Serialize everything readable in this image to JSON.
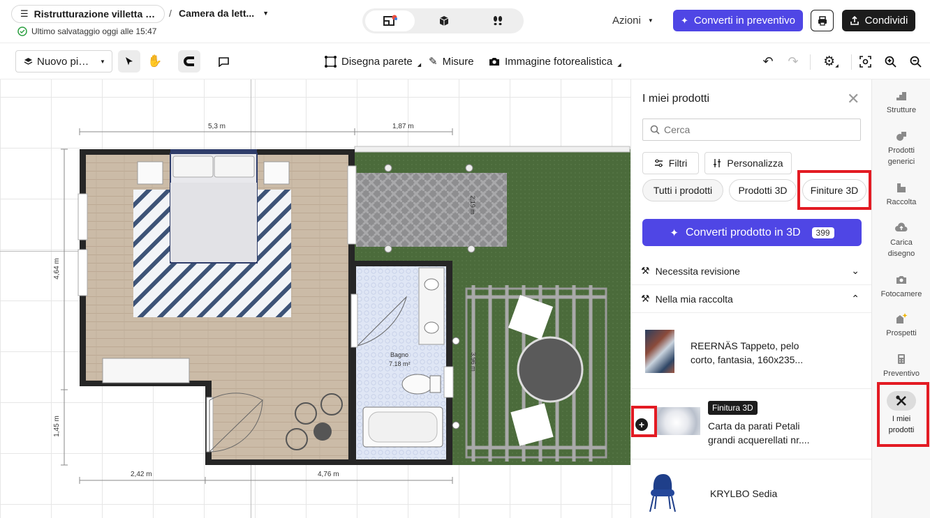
{
  "topbar": {
    "project_title": "Ristrutturazione villetta a ...",
    "separator": "/",
    "room_title": "Camera da lett...",
    "save_status": "Ultimo salvataggio oggi alle 15:47",
    "actions_label": "Azioni",
    "convert_button": "Converti in preventivo",
    "share_button": "Condividi"
  },
  "toolbar": {
    "floor_select": "Nuovo pia...",
    "draw_wall": "Disegna parete",
    "measures": "Misure",
    "photo_image": "Immagine fotorealistica"
  },
  "canvas": {
    "dim_top_left": "5,3 m",
    "dim_top_right": "1,87 m",
    "dim_left_top": "4,64 m",
    "dim_left_bottom": "1,45 m",
    "dim_bottom_left": "2,42 m",
    "dim_bottom_right": "4,76 m",
    "patio_dim": "2,19 m",
    "pergola_dim": "3,96 m",
    "bathroom_name": "Bagno",
    "bathroom_area": "7.18 m²"
  },
  "panel": {
    "title": "I miei prodotti",
    "search_placeholder": "Cerca",
    "filters_button": "Filtri",
    "customize_button": "Personalizza",
    "chips": [
      "Tutti i prodotti",
      "Prodotti 3D",
      "Finiture 3D"
    ],
    "convert_3d_button": "Converti prodotto in 3D",
    "convert_3d_count": "399",
    "section_review": "Necessita revisione",
    "section_collection": "Nella mia raccolta",
    "products": [
      {
        "name": "REERNÄS Tappeto, pelo corto, fantasia, 160x235..."
      },
      {
        "badge": "Finitura 3D",
        "name": "Carta da parati Petali grandi acquerellati nr...."
      },
      {
        "name": "KRYLBO Sedia"
      }
    ]
  },
  "rail": {
    "items": [
      "Strutture",
      "Prodotti generici",
      "Raccolta",
      "Carica disegno",
      "Fotocamere",
      "Prospetti",
      "Preventivo",
      "I miei prodotti"
    ]
  },
  "colors": {
    "accent": "#4f46e5",
    "highlight": "#e31b23",
    "grass": "#4a6b3a",
    "wall": "#262626",
    "floor_wood": "#c9b9a5"
  }
}
